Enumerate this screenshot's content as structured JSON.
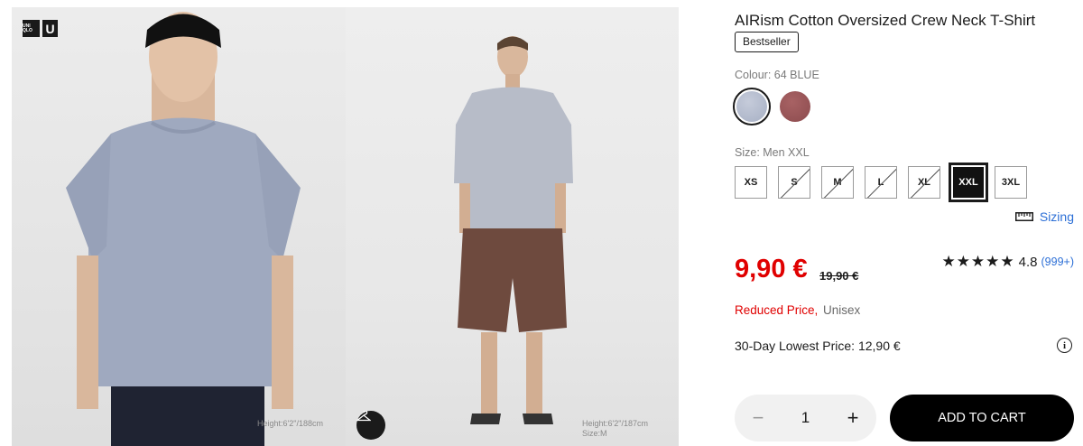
{
  "gallery": {
    "brand_top": "UNI QLO",
    "brand_u": "U",
    "photo1_model_info": [
      "Height:6'2\"/188cm"
    ],
    "photo2_model_info": [
      "Height:6'2\"/187cm",
      "Size:M"
    ]
  },
  "product": {
    "title": "AIRism Cotton Oversized Crew Neck T-Shirt",
    "badge": "Bestseller",
    "colour_label": "Colour: 64 BLUE",
    "colours": [
      {
        "name": "64 BLUE",
        "hex": "#a7b0c4",
        "selected": true
      },
      {
        "name": "red",
        "hex": "#8c4b4e",
        "selected": false
      }
    ],
    "size_label": "Size: Men XXL",
    "sizes": [
      {
        "label": "XS",
        "available": true
      },
      {
        "label": "S",
        "available": false
      },
      {
        "label": "M",
        "available": false
      },
      {
        "label": "L",
        "available": false
      },
      {
        "label": "XL",
        "available": false
      },
      {
        "label": "XXL",
        "available": true,
        "selected": true
      },
      {
        "label": "3XL",
        "available": true
      }
    ],
    "sizing_link": "Sizing",
    "price": "9,90 €",
    "old_price": "19,90 €",
    "rating_stars": "★★★★★",
    "rating_value": "4.8",
    "rating_count": "(999+)",
    "reduced_label": "Reduced Price,",
    "unisex_label": "Unisex",
    "lowest_price": "30-Day Lowest Price: 12,90 €",
    "quantity": "1",
    "add_to_cart": "ADD TO CART"
  },
  "colors": {
    "accent_red": "#e00000",
    "link_blue": "#2c6fd6",
    "primary_black": "#000000"
  }
}
